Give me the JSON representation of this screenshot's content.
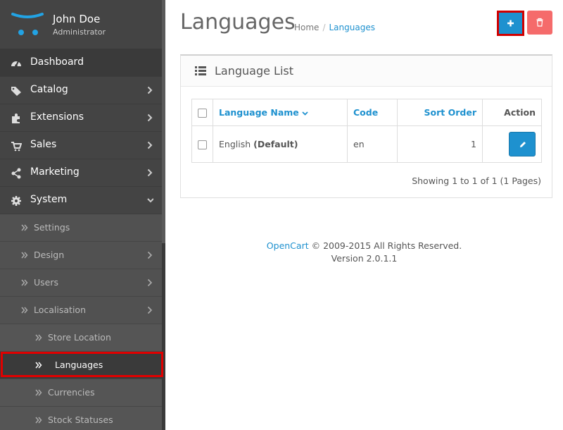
{
  "user": {
    "name": "John Doe",
    "role": "Administrator"
  },
  "sidebar": {
    "menu": [
      {
        "label": "Dashboard",
        "icon": "dashboard-icon"
      },
      {
        "label": "Catalog",
        "icon": "tags-icon"
      },
      {
        "label": "Extensions",
        "icon": "puzzle-icon"
      },
      {
        "label": "Sales",
        "icon": "shopping-cart-icon"
      },
      {
        "label": "Marketing",
        "icon": "share-icon"
      },
      {
        "label": "System",
        "icon": "cog-icon"
      }
    ],
    "system_sub": [
      {
        "label": "Settings"
      },
      {
        "label": "Design"
      },
      {
        "label": "Users"
      },
      {
        "label": "Localisation"
      }
    ],
    "localisation_sub": [
      {
        "label": "Store Location"
      },
      {
        "label": "Languages"
      },
      {
        "label": "Currencies"
      },
      {
        "label": "Stock Statuses"
      }
    ]
  },
  "page": {
    "title": "Languages",
    "breadcrumb": [
      "Home",
      "Languages"
    ],
    "breadcrumb_sep": "/"
  },
  "panel": {
    "title": "Language List",
    "columns": [
      "Language Name",
      "Code",
      "Sort Order",
      "Action"
    ],
    "rows": [
      {
        "name": "English",
        "name_suffix": "(Default)",
        "code": "en",
        "sort_order": "1"
      }
    ],
    "showing": "Showing 1 to 1 of 1 (1 Pages)"
  },
  "footer": {
    "brand": "OpenCart",
    "copyright": " © 2009-2015 All Rights Reserved.",
    "version": "Version 2.0.1.1"
  },
  "colors": {
    "accent": "#1e91cf",
    "danger": "#f56b6b",
    "sidebar": "#444444",
    "highlight": "#e00000"
  }
}
